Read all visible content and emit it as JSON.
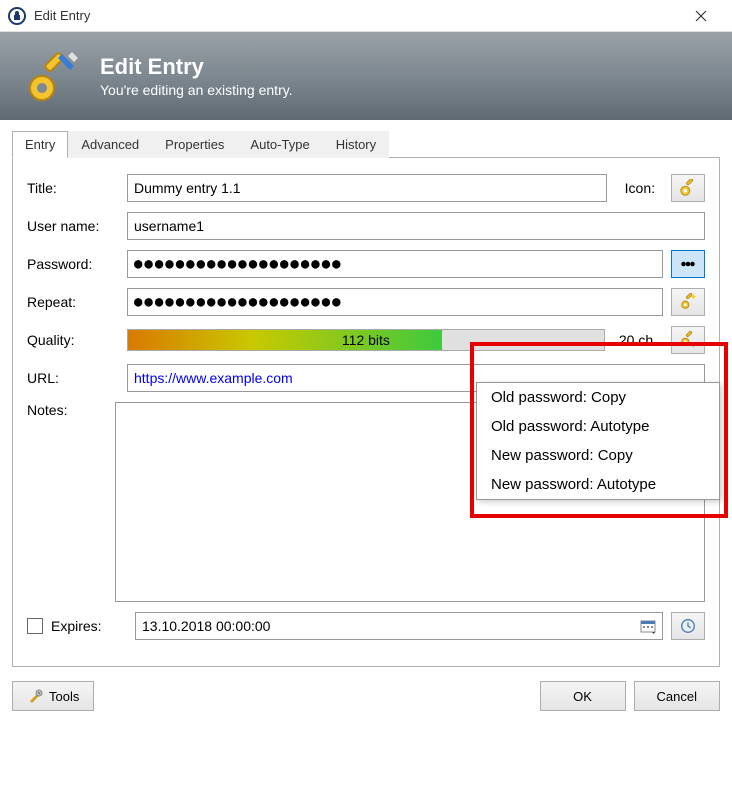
{
  "window": {
    "title": "Edit Entry"
  },
  "header": {
    "title": "Edit Entry",
    "subtitle": "You're editing an existing entry."
  },
  "tabs": [
    "Entry",
    "Advanced",
    "Properties",
    "Auto-Type",
    "History"
  ],
  "labels": {
    "title": "Title:",
    "username": "User name:",
    "password": "Password:",
    "repeat": "Repeat:",
    "quality": "Quality:",
    "url": "URL:",
    "notes": "Notes:",
    "expires": "Expires:",
    "icon": "Icon:"
  },
  "fields": {
    "title": "Dummy entry 1.1",
    "username": "username1",
    "password": "●●●●●●●●●●●●●●●●●●●●",
    "repeat": "●●●●●●●●●●●●●●●●●●●●",
    "quality_bits": "112 bits",
    "char_count": "20 ch.",
    "url": "https://www.example.com",
    "notes": "",
    "expires_date": "13.10.2018 00:00:00"
  },
  "dropdown": {
    "items": [
      "Old password: Copy",
      "Old password: Autotype",
      "New password: Copy",
      "New password: Autotype"
    ]
  },
  "buttons": {
    "tools": "Tools",
    "ok": "OK",
    "cancel": "Cancel"
  }
}
